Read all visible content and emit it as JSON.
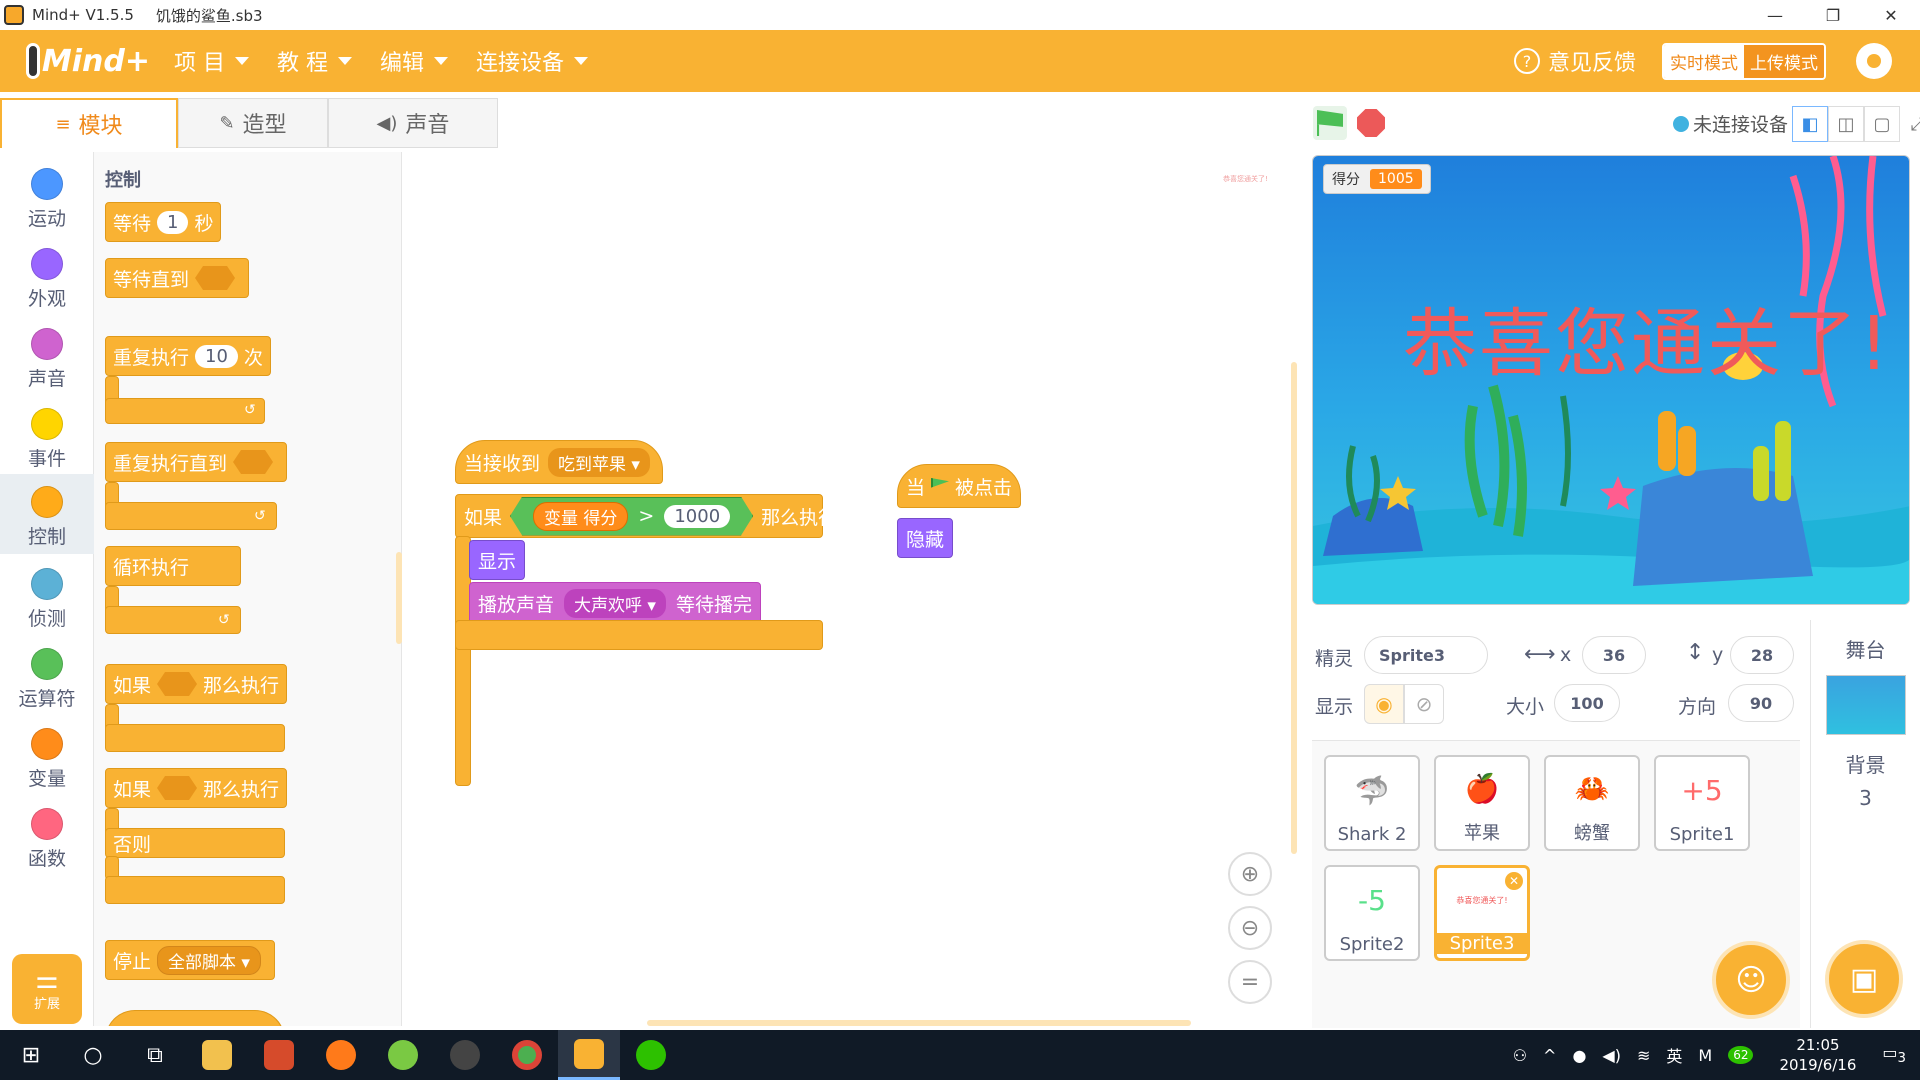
{
  "window": {
    "app_title": "Mind+ V1.5.5",
    "file_name": "饥饿的鲨鱼.sb3",
    "minimize": "—",
    "restore": "❐",
    "close": "✕"
  },
  "menubar": {
    "logo": "Mind+",
    "items": [
      {
        "label": "项 目"
      },
      {
        "label": "教 程"
      },
      {
        "label": "编辑"
      },
      {
        "label": "连接设备"
      }
    ],
    "feedback": "意见反馈",
    "mode_realtime": "实时模式",
    "mode_upload": "上传模式"
  },
  "tabs": [
    {
      "label": "模块",
      "icon": "≡"
    },
    {
      "label": "造型",
      "icon": "✎"
    },
    {
      "label": "声音",
      "icon": "◀)"
    }
  ],
  "categories": [
    {
      "label": "运动",
      "color": "#4c97ff"
    },
    {
      "label": "外观",
      "color": "#9966ff"
    },
    {
      "label": "声音",
      "color": "#cf63cf"
    },
    {
      "label": "事件",
      "color": "#ffd500"
    },
    {
      "label": "控制",
      "color": "#ffab19"
    },
    {
      "label": "侦测",
      "color": "#5cb1d6"
    },
    {
      "label": "运算符",
      "color": "#59c059"
    },
    {
      "label": "变量",
      "color": "#ff8c1a"
    },
    {
      "label": "函数",
      "color": "#ff6680"
    }
  ],
  "extension": {
    "label": "扩展"
  },
  "palette": {
    "title": "控制",
    "wait": {
      "pre": "等待",
      "value": "1",
      "post": "秒"
    },
    "wait_until": "等待直到",
    "repeat": {
      "pre": "重复执行",
      "value": "10",
      "post": "次"
    },
    "repeat_until": "重复执行直到",
    "forever": "循环执行",
    "if_then": {
      "pre": "如果",
      "post": "那么执行"
    },
    "if_else": {
      "pre": "如果",
      "post": "那么执行",
      "else": "否则"
    },
    "stop": {
      "label": "停止",
      "option": "全部脚本"
    }
  },
  "workspace": {
    "hint": "恭喜您通关了!",
    "script1": {
      "hat": "当接收到",
      "message": "吃到苹果",
      "if": "如果",
      "var": "变量 得分",
      "op": ">",
      "num": "1000",
      "then": "那么执行",
      "show": "显示",
      "play": "播放声音",
      "sound": "大声欢呼",
      "until": "等待播完"
    },
    "script2": {
      "when": "当",
      "clicked": "被点击",
      "hide": "隐藏"
    },
    "zoom_in": "⊕",
    "zoom_out": "⊖",
    "zoom_reset": "="
  },
  "stage_bar": {
    "device": "未连接设备"
  },
  "stage": {
    "score_label": "得分",
    "score_value": "1005",
    "congrats": "恭喜您通关了!"
  },
  "sprite_info": {
    "sprite_label": "精灵",
    "sprite_name": "Sprite3",
    "x_label": "x",
    "x": "36",
    "y_label": "y",
    "y": "28",
    "show_label": "显示",
    "size_label": "大小",
    "size": "100",
    "dir_label": "方向",
    "direction": "90"
  },
  "sprites": [
    {
      "name": "Shark 2",
      "thumb": "🦈"
    },
    {
      "name": "苹果",
      "thumb": "🍎"
    },
    {
      "name": "螃蟹",
      "thumb": "🦀"
    },
    {
      "name": "Sprite1",
      "thumb": "+5"
    },
    {
      "name": "Sprite2",
      "thumb": "-5"
    },
    {
      "name": "Sprite3",
      "thumb": "恭喜您通关了!"
    }
  ],
  "stage_pane": {
    "title": "舞台",
    "bg_label": "背景",
    "bg_count": "3"
  },
  "taskbar": {
    "time": "21:05",
    "date": "2019/6/16",
    "ime": "英",
    "badge": "62",
    "notif": "3"
  }
}
